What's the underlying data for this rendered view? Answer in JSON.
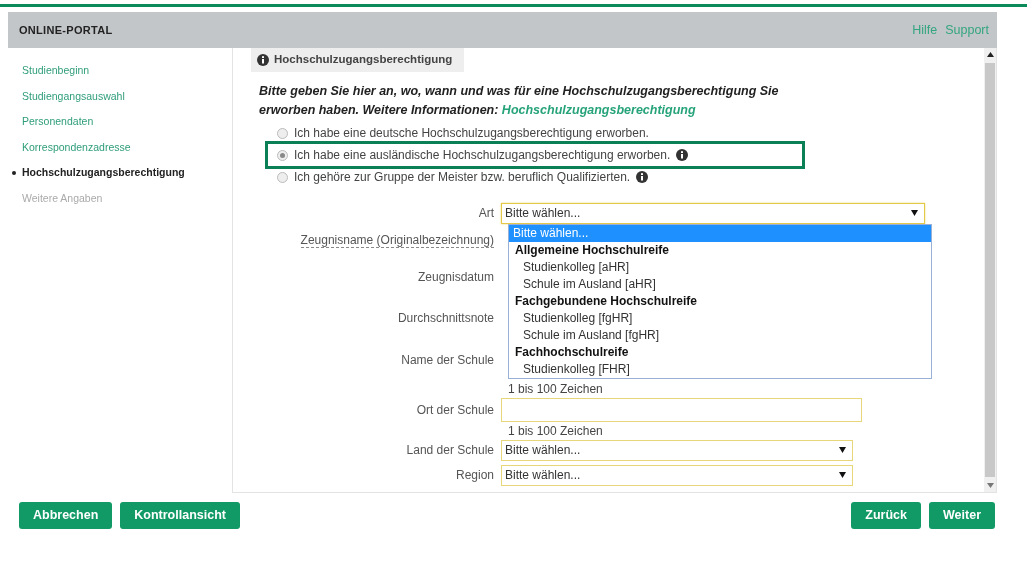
{
  "header": {
    "title": "ONLINE-PORTAL",
    "links": [
      "Hilfe",
      "Support"
    ]
  },
  "sidebar": {
    "items": [
      {
        "label": "Studienbeginn",
        "selected": false,
        "disabled": false
      },
      {
        "label": "Studiengangsauswahl",
        "selected": false,
        "disabled": false
      },
      {
        "label": "Personendaten",
        "selected": false,
        "disabled": false
      },
      {
        "label": "Korrespondenzadresse",
        "selected": false,
        "disabled": false
      },
      {
        "label": "Hochschulzugangsberechtigung",
        "selected": true,
        "disabled": false
      },
      {
        "label": "Weitere Angaben",
        "selected": false,
        "disabled": true
      }
    ]
  },
  "section": {
    "title": "Hochschulzugangsberechtigung",
    "intro": "Bitte geben Sie hier an, wo, wann und was für eine Hochschulzugangsberechtigung Sie erworben haben. Weitere Informationen:",
    "intro_link": "Hochschulzugangsberechtigung"
  },
  "options": [
    {
      "label": "Ich habe eine deutsche Hochschulzugangsberechtigung erworben.",
      "selected": false,
      "info": false,
      "highlighted": false
    },
    {
      "label": "Ich habe eine ausländische Hochschulzugangsberechtigung erworben.",
      "selected": true,
      "info": true,
      "highlighted": true
    },
    {
      "label": "Ich gehöre zur Gruppe der Meister bzw. beruflich Qualifizierten.",
      "selected": false,
      "info": true,
      "highlighted": false
    }
  ],
  "fields": [
    {
      "label": "Art",
      "kind": "select",
      "value": "Bitte wählen...",
      "open": true,
      "underlined": false
    },
    {
      "label": "Zeugnisname (Originalbezeichnung)",
      "kind": "covered",
      "underlined": true
    },
    {
      "label": "Zeugnisdatum",
      "kind": "covered",
      "underlined": false
    },
    {
      "label": "Durchschnittsnote",
      "kind": "covered",
      "underlined": false
    },
    {
      "label": "Name der Schule",
      "kind": "covered",
      "underlined": false,
      "hint": "1 bis 100 Zeichen"
    },
    {
      "label": "Ort der Schule",
      "kind": "input",
      "underlined": false,
      "hint": "1 bis 100 Zeichen"
    },
    {
      "label": "Land der Schule",
      "kind": "select",
      "value": "Bitte wählen...",
      "open": false,
      "underlined": false
    },
    {
      "label": "Region",
      "kind": "select",
      "value": "Bitte wählen...",
      "open": false,
      "underlined": false
    }
  ],
  "dropdown": {
    "items": [
      {
        "label": "Bitte wählen...",
        "kind": "option",
        "selected": true
      },
      {
        "label": "Allgemeine Hochschulreife",
        "kind": "group",
        "selected": false
      },
      {
        "label": "Studienkolleg [aHR]",
        "kind": "option",
        "selected": false
      },
      {
        "label": "Schule im Ausland [aHR]",
        "kind": "option",
        "selected": false
      },
      {
        "label": "Fachgebundene Hochschulreife",
        "kind": "group",
        "selected": false
      },
      {
        "label": "Studienkolleg [fgHR]",
        "kind": "option",
        "selected": false
      },
      {
        "label": "Schule im Ausland [fgHR]",
        "kind": "option",
        "selected": false
      },
      {
        "label": "Fachhochschulreife",
        "kind": "group",
        "selected": false
      },
      {
        "label": "Studienkolleg [FHR]",
        "kind": "option",
        "selected": false
      }
    ]
  },
  "buttons_left": [
    "Abbrechen",
    "Kontrollansicht"
  ],
  "buttons_right": [
    "Zurück",
    "Weiter"
  ]
}
